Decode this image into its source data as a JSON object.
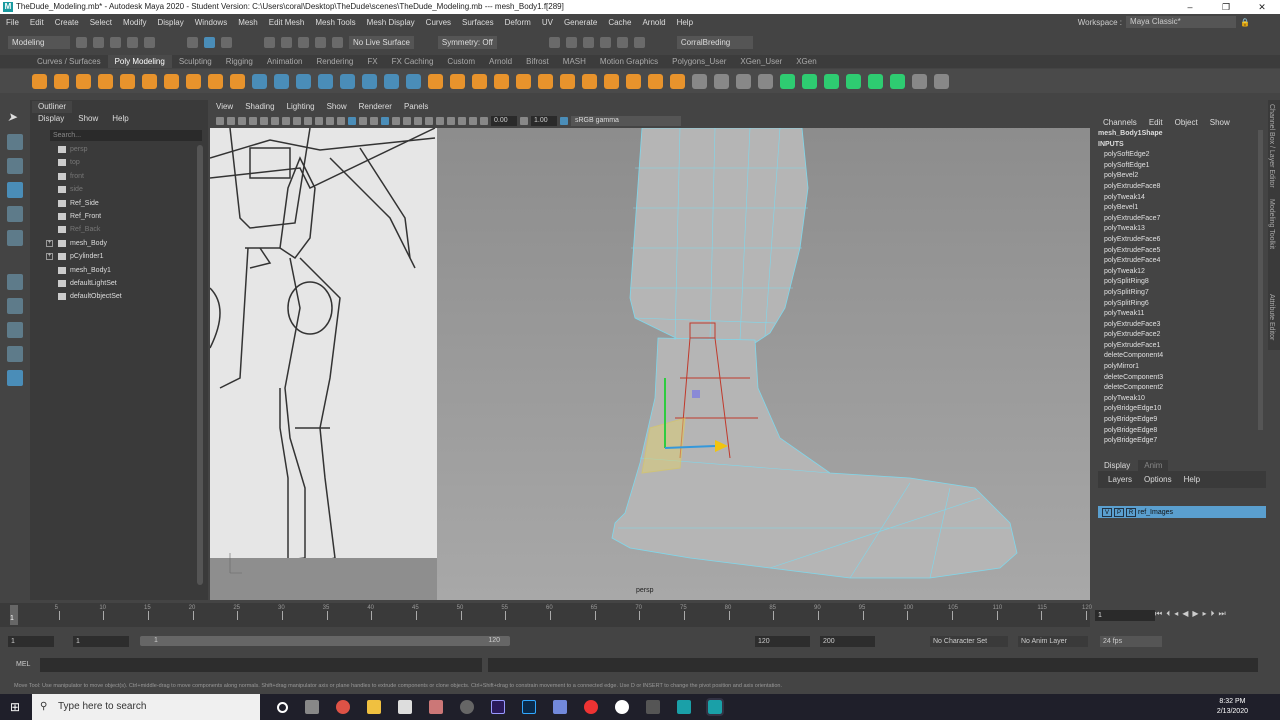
{
  "title": "TheDude_Modeling.mb* - Autodesk Maya 2020 - Student Version: C:\\Users\\coral\\Desktop\\TheDude\\scenes\\TheDude_Modeling.mb  ---  mesh_Body1.f[289]",
  "menus": [
    "File",
    "Edit",
    "Create",
    "Select",
    "Modify",
    "Display",
    "Windows",
    "Mesh",
    "Edit Mesh",
    "Mesh Tools",
    "Mesh Display",
    "Curves",
    "Surfaces",
    "Deform",
    "UV",
    "Generate",
    "Cache",
    "Arnold",
    "Help"
  ],
  "workspace": {
    "label": "Workspace :",
    "value": "Maya Classic*"
  },
  "status": {
    "mode": "Modeling",
    "live_surface": "No Live Surface",
    "symmetry": "Symmetry: Off",
    "user": "CorralBreding"
  },
  "shelf_tabs": [
    "Curves / Surfaces",
    "Poly Modeling",
    "Sculpting",
    "Rigging",
    "Animation",
    "Rendering",
    "FX",
    "FX Caching",
    "Custom",
    "Arnold",
    "Bifrost",
    "MASH",
    "Motion Graphics",
    "Polygons_User",
    "XGen_User",
    "XGen"
  ],
  "outliner": {
    "tab": "Outliner",
    "menu": [
      "Display",
      "Show",
      "Help"
    ],
    "search_placeholder": "Search...",
    "items": [
      {
        "label": "persp",
        "dim": true
      },
      {
        "label": "top",
        "dim": true
      },
      {
        "label": "front",
        "dim": true
      },
      {
        "label": "side",
        "dim": true
      },
      {
        "label": "Ref_Side"
      },
      {
        "label": "Ref_Front"
      },
      {
        "label": "Ref_Back",
        "dim": true
      },
      {
        "label": "mesh_Body",
        "exp": true
      },
      {
        "label": "pCylinder1",
        "exp": true
      },
      {
        "label": "mesh_Body1"
      },
      {
        "label": "defaultLightSet"
      },
      {
        "label": "defaultObjectSet"
      }
    ]
  },
  "viewport": {
    "menu": [
      "View",
      "Shading",
      "Lighting",
      "Show",
      "Renderer",
      "Panels"
    ],
    "exposure": "0.00",
    "gamma": "1.00",
    "colorspace": "sRGB gamma",
    "camera": "persp"
  },
  "channelbox": {
    "menu": [
      "Channels",
      "Edit",
      "Object",
      "Show"
    ],
    "shape": "mesh_Body1Shape",
    "inputs_label": "INPUTS",
    "inputs": [
      "polySoftEdge2",
      "polySoftEdge1",
      "polyBevel2",
      "polyExtrudeFace8",
      "polyTweak14",
      "polyBevel1",
      "polyExtrudeFace7",
      "polyTweak13",
      "polyExtrudeFace6",
      "polyExtrudeFace5",
      "polyExtrudeFace4",
      "polyTweak12",
      "polySplitRing8",
      "polySplitRing7",
      "polySplitRing6",
      "polyTweak11",
      "polyExtrudeFace3",
      "polyExtrudeFace2",
      "polyExtrudeFace1",
      "deleteComponent4",
      "polyMirror1",
      "deleteComponent3",
      "deleteComponent2",
      "polyTweak10",
      "polyBridgeEdge10",
      "polyBridgeEdge9",
      "polyBridgeEdge8",
      "polyBridgeEdge7"
    ]
  },
  "layers": {
    "tabs": [
      "Display",
      "Anim"
    ],
    "menu": [
      "Layers",
      "Options",
      "Help"
    ],
    "layer": {
      "v": "V",
      "p": "P",
      "r": "R",
      "name": "ref_Images"
    }
  },
  "side_tabs": [
    "Channel Box / Layer Editor",
    "Modeling Toolkit",
    "Attribute Editor"
  ],
  "timeline": {
    "ticks": [
      "5",
      "10",
      "15",
      "20",
      "25",
      "30",
      "35",
      "40",
      "45",
      "50",
      "55",
      "60",
      "65",
      "70",
      "75",
      "80",
      "85",
      "90",
      "95",
      "100",
      "105",
      "110",
      "115",
      "120"
    ],
    "current": "1",
    "current_field": "1"
  },
  "range": {
    "start": "1",
    "start2": "1",
    "slider_start": "1",
    "slider_end": "120",
    "end": "120",
    "end2": "200",
    "char_set": "No Character Set",
    "anim_layer": "No Anim Layer",
    "fps": "24 fps"
  },
  "mel": {
    "label": "MEL"
  },
  "help": "Move Tool: Use manipulator to move object(s). Ctrl+middle-drag to move components along normals. Shift+drag manipulator axis or plane handles to extrude components or clone objects. Ctrl+Shift+drag to constrain movement to a connected edge. Use D or INSERT to change the pivot position and axis orientation.",
  "taskbar": {
    "search": "Type here to search",
    "time": "8:32 PM",
    "date": "2/13/2020"
  }
}
